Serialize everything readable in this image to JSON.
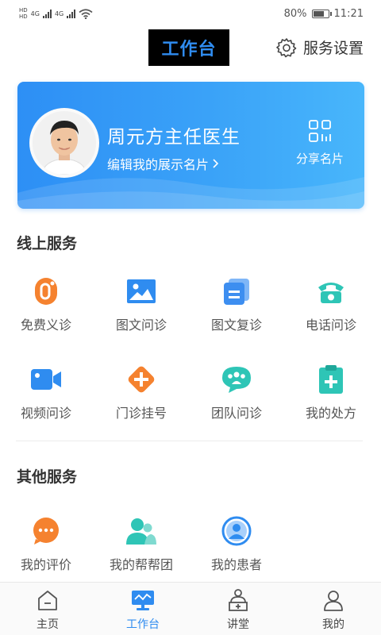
{
  "status_bar": {
    "network_1": "4G",
    "network_2": "4G",
    "battery_percent": "80%",
    "battery_level": 0.8,
    "time": "11:21"
  },
  "header": {
    "title": "工作台",
    "settings_label": "服务设置"
  },
  "profile_card": {
    "doctor_name": "周元方主任医生",
    "edit_label": "编辑我的展示名片",
    "share_label": "分享名片"
  },
  "online_services": {
    "title": "线上服务",
    "items": [
      {
        "label": "免费义诊",
        "icon": "free-clinic-icon",
        "color": "#f5822f"
      },
      {
        "label": "图文问诊",
        "icon": "image-text-consult-icon",
        "color": "#2f8cf0"
      },
      {
        "label": "图文复诊",
        "icon": "image-text-revisit-icon",
        "color": "#3d8ef0"
      },
      {
        "label": "电话问诊",
        "icon": "phone-consult-icon",
        "color": "#2ec5b6"
      },
      {
        "label": "视频问诊",
        "icon": "video-consult-icon",
        "color": "#2f8cf0"
      },
      {
        "label": "门诊挂号",
        "icon": "outpatient-register-icon",
        "color": "#f5822f"
      },
      {
        "label": "团队问诊",
        "icon": "team-consult-icon",
        "color": "#2ec5b6"
      },
      {
        "label": "我的处方",
        "icon": "prescription-icon",
        "color": "#2ec5b6"
      }
    ]
  },
  "other_services": {
    "title": "其他服务",
    "items": [
      {
        "label": "我的评价",
        "icon": "my-review-icon",
        "color": "#f5822f"
      },
      {
        "label": "我的帮帮团",
        "icon": "my-help-group-icon",
        "color": "#2ec5b6"
      },
      {
        "label": "我的患者",
        "icon": "my-patients-icon",
        "color": "#2f8cf0"
      }
    ]
  },
  "bottom_nav": {
    "items": [
      {
        "label": "主页",
        "icon": "home-icon",
        "active": false
      },
      {
        "label": "工作台",
        "icon": "workbench-icon",
        "active": true
      },
      {
        "label": "讲堂",
        "icon": "lecture-hall-icon",
        "active": false
      },
      {
        "label": "我的",
        "icon": "profile-icon",
        "active": false
      }
    ]
  },
  "colors": {
    "accent": "#2f8cf0",
    "orange": "#f5822f",
    "teal": "#2ec5b6"
  }
}
